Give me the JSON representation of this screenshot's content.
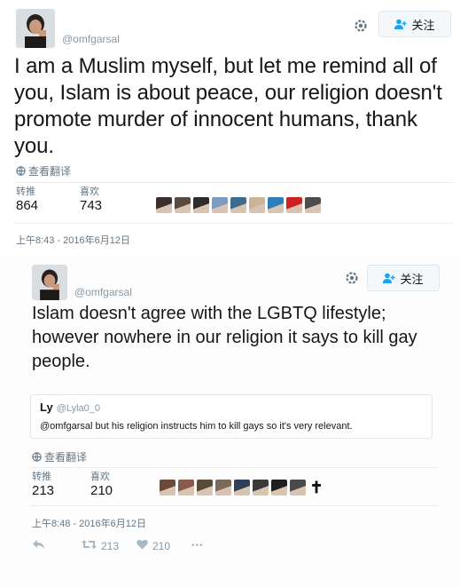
{
  "colors": {
    "accent": "#1da1f2",
    "text": "#14171a",
    "muted": "#657786"
  },
  "tweet1": {
    "handle": "@omfgarsal",
    "follow_label": "关注",
    "text": "I am a Muslim myself, but let me remind all of you, Islam is about peace, our religion doesn't promote murder of innocent humans, thank you.",
    "translate_label": "查看翻译",
    "retweets_label": "转推",
    "retweets": "864",
    "likes_label": "喜欢",
    "likes": "743",
    "timestamp": "上午8:43 - 2016年6月12日",
    "likers": [
      "#3a2f2a",
      "#5b4a3e",
      "#2c2c2c",
      "#7a9cc1",
      "#3e6b8f",
      "#c9b49a",
      "#2a7fb8",
      "#cc2222",
      "#4d4d4d"
    ]
  },
  "tweet2": {
    "handle": "@omfgarsal",
    "follow_label": "关注",
    "text": "Islam doesn't agree with the LGBTQ lifestyle; however nowhere in our religion it says to kill gay people.",
    "quote": {
      "name": "Ly",
      "handle": "@Lyla0_0",
      "text": "@omfgarsal but his religion instructs him to kill gays so it's very relevant."
    },
    "translate_label": "查看翻译",
    "retweets_label": "转推",
    "retweets": "213",
    "likes_label": "喜欢",
    "likes": "210",
    "timestamp": "上午8:48 - 2016年6月12日",
    "likers": [
      "#6b4a3a",
      "#8a5a4a",
      "#5a4a3a",
      "#7a6a5a",
      "#2f3f5a",
      "#3a3a3a",
      "#1f1f1f",
      "#4a4a4a"
    ],
    "liker_cross": "✝",
    "action_retweets": "213",
    "action_likes": "210",
    "more_label": "•••"
  }
}
